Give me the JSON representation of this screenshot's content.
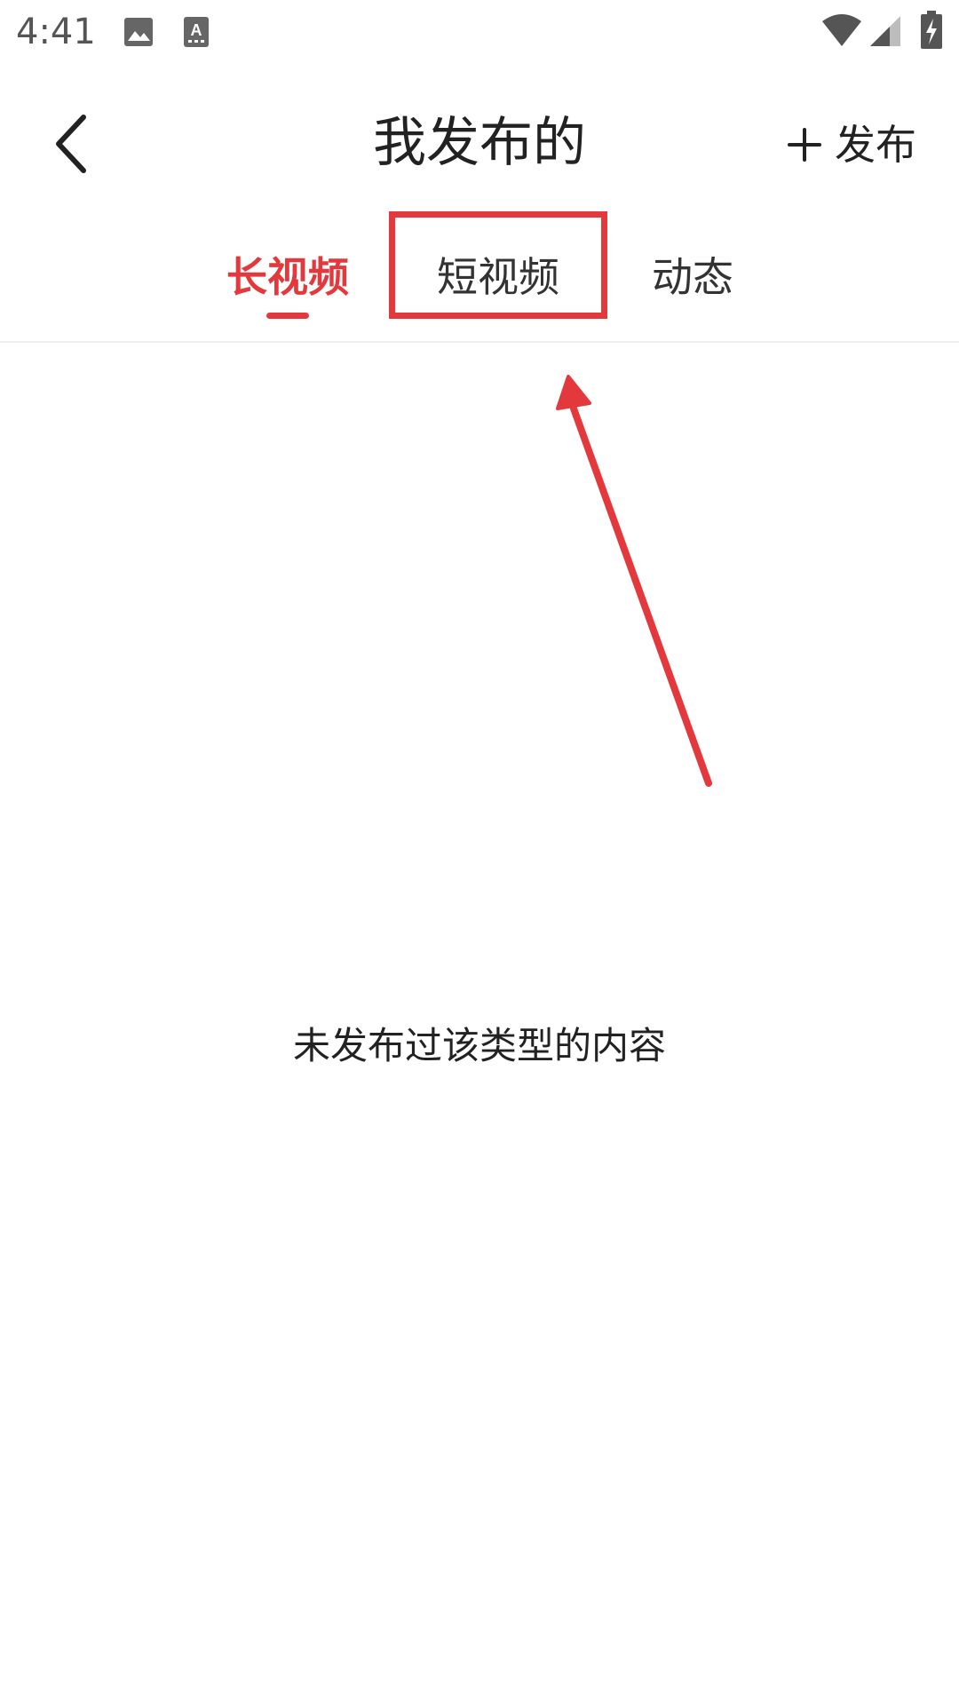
{
  "status_bar": {
    "time": "4:41",
    "icons": [
      "image-icon",
      "text-a-icon",
      "wifi-icon",
      "signal-icon",
      "battery-charging-icon"
    ]
  },
  "app_bar": {
    "back_icon": "chevron-left-icon",
    "title": "我发布的",
    "publish_icon": "plus-icon",
    "publish_label": "发布"
  },
  "tabs": [
    {
      "label": "长视频",
      "active": true
    },
    {
      "label": "短视频",
      "active": false
    },
    {
      "label": "动态",
      "active": false
    }
  ],
  "empty_state": {
    "message": "未发布过该类型的内容"
  },
  "colors": {
    "accent": "#e4393c",
    "text": "#222222",
    "divider": "#eeeeee"
  }
}
